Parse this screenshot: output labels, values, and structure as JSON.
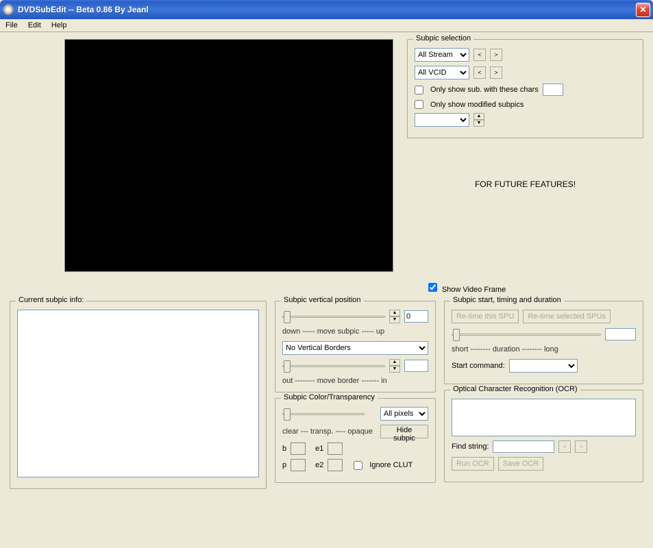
{
  "title": "DVDSubEdit  -- Beta 0.86 By Jeanl",
  "menu": {
    "file": "File",
    "edit": "Edit",
    "help": "Help"
  },
  "subpic_sel": {
    "title": "Subpic selection",
    "stream": "All Stream",
    "vcid": "All VCID",
    "only_chars": "Only show sub. with these chars",
    "only_modified": "Only show modified subpics"
  },
  "future": "FOR FUTURE FEATURES!",
  "show_video": "Show Video Frame",
  "info": {
    "title": "Current subpic info:"
  },
  "vpos": {
    "title": "Subpic vertical position",
    "val": "0",
    "hint1": "down ----- move subpic ----- up",
    "borders": "No Vertical Borders",
    "hint2": "out -------- move border ------- in"
  },
  "color": {
    "title": "Subpic Color/Transparency",
    "hint": "clear --- transp. ---- opaque",
    "allpix": "All pixels",
    "hide": "Hide subpic",
    "b": "b",
    "p": "p",
    "e1": "e1",
    "e2": "e2",
    "ignore": "Ignore CLUT"
  },
  "timing": {
    "title": "Subpic start, timing and duration",
    "retime_this": "Re-time this SPU",
    "retime_sel": "Re-time selected SPUs",
    "hint": "short -------- duration -------- long",
    "start_cmd": "Start command:"
  },
  "ocr": {
    "title": "Optical Character Recognition (OCR)",
    "find": "Find string:",
    "run": "Run OCR",
    "save": "Save OCR"
  }
}
